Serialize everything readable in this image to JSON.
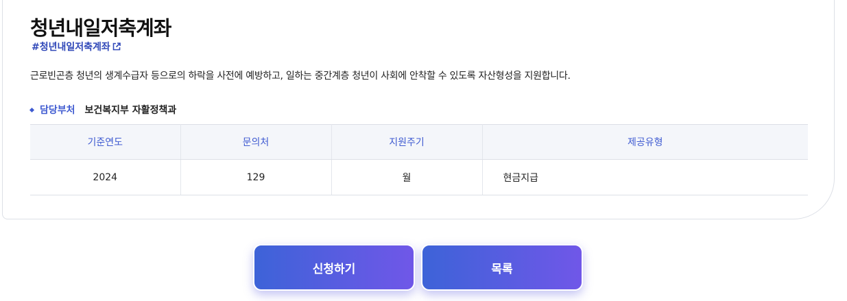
{
  "program": {
    "title": "청년내일저축계좌",
    "hashtag": "#청년내일저축계좌",
    "description": "근로빈곤층 청년의 생계수급자 등으로의 하락을 사전에 예방하고, 일하는 중간계층 청년이 사회에 안착할 수 있도록 자산형성을 지원합니다.",
    "department_label": "담당부처",
    "department_value": "보건복지부 자활정책과"
  },
  "table": {
    "headers": [
      "기준연도",
      "문의처",
      "지원주기",
      "제공유형"
    ],
    "row": [
      "2024",
      "129",
      "월",
      "현금지급"
    ]
  },
  "buttons": {
    "apply": "신청하기",
    "list": "목록"
  },
  "colors": {
    "accent": "#3f5bd1",
    "button_gradient_start": "#3d63d8",
    "button_gradient_end": "#7057e8"
  },
  "icons": {
    "hashtag_link": "external-link-icon",
    "department_bullet": "diamond-bullet-icon"
  }
}
